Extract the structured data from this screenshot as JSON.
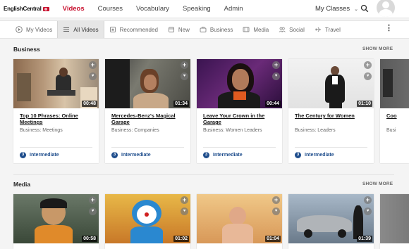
{
  "header": {
    "logo_text": "EnglishCentral",
    "nav": [
      "Videos",
      "Courses",
      "Vocabulary",
      "Speaking",
      "Admin"
    ],
    "my_classes_label": "My Classes",
    "accent_color": "#c8102e"
  },
  "filters": [
    "My Videos",
    "All Videos",
    "Recommended",
    "New",
    "Business",
    "Media",
    "Social",
    "Travel"
  ],
  "sections": [
    {
      "title": "Business",
      "show_more": "SHOW MORE",
      "cards": [
        {
          "title": "Top 10 Phrases: Online Meetings",
          "category": "Business: Meetings",
          "duration": "00:48",
          "level_num": "3",
          "level": "Intermediate"
        },
        {
          "title": "Mercedes-Benz's Magical Garage",
          "category": "Business: Companies",
          "duration": "01:34",
          "level_num": "3",
          "level": "Intermediate"
        },
        {
          "title": "Leave Your Crown in the Garage",
          "category": "Business: Women Leaders",
          "duration": "00:44",
          "level_num": "3",
          "level": "Intermediate"
        },
        {
          "title": "The Century for Women",
          "category": "Business: Leaders",
          "duration": "01:10",
          "level_num": "3",
          "level": "Intermediate"
        },
        {
          "title": "Coo",
          "category": "Busi",
          "duration": "",
          "level_num": "",
          "level": ""
        }
      ]
    },
    {
      "title": "Media",
      "show_more": "SHOW MORE",
      "cards": [
        {
          "duration": "00:58"
        },
        {
          "duration": "01:02"
        },
        {
          "duration": "01:04"
        },
        {
          "duration": "01:39"
        },
        {
          "duration": ""
        }
      ]
    }
  ]
}
